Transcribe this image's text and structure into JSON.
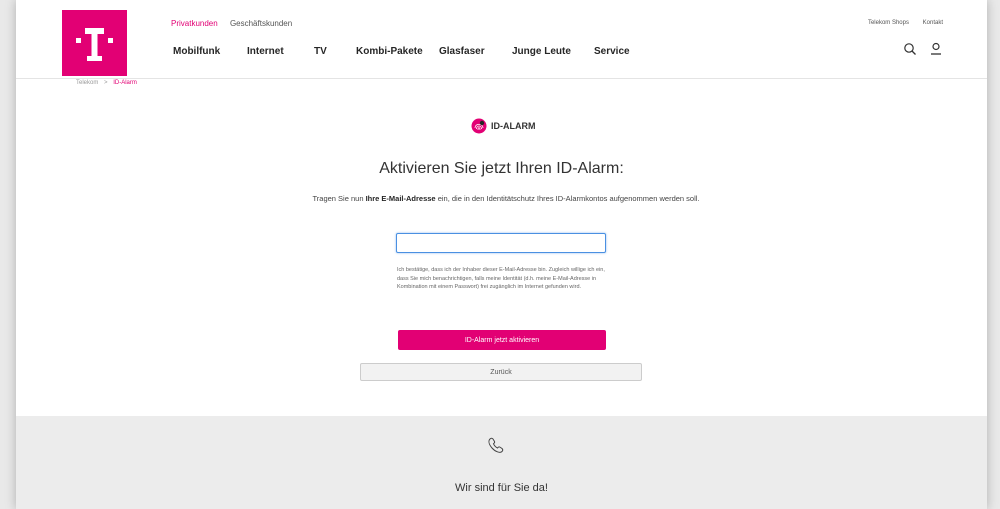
{
  "header": {
    "segments": [
      "Privatkunden",
      "Geschäftskunden"
    ],
    "top_links": [
      "Telekom Shops",
      "Kontakt"
    ],
    "nav": [
      "Mobilfunk",
      "Internet",
      "TV",
      "Kombi-Pakete",
      "Glasfaser",
      "Junge Leute",
      "Service"
    ]
  },
  "breadcrumb": {
    "home": "Telekom",
    "separator": ">",
    "current": "ID-Alarm"
  },
  "brand": "ID-ALARM",
  "main": {
    "title": "Aktivieren Sie jetzt Ihren ID-Alarm:",
    "intro_before": "Tragen Sie nun ",
    "intro_bold": "Ihre E-Mail-Adresse",
    "intro_after": " ein, die in den Identitätschutz Ihres ID-Alarmkontos aufgenommen werden soll.",
    "consent": "Ich bestätige, dass ich der Inhaber dieser E-Mail-Adresse bin. Zugleich willige ich ein, dass Sie mich benachrichtigen, falls meine Identität (d.h. meine E-Mail-Adresse in Kombination mit einem Passwort) frei zugänglich im Internet gefunden wird.",
    "activate_label": "ID-Alarm jetzt aktivieren",
    "back_label": "Zurück"
  },
  "footer": {
    "title": "Wir sind für Sie da!"
  },
  "colors": {
    "brand": "#e20074",
    "focus": "#4a90e2"
  },
  "icons": [
    "telekom-logo-icon",
    "search-icon",
    "user-icon",
    "fingerprint-icon",
    "phone-icon"
  ]
}
